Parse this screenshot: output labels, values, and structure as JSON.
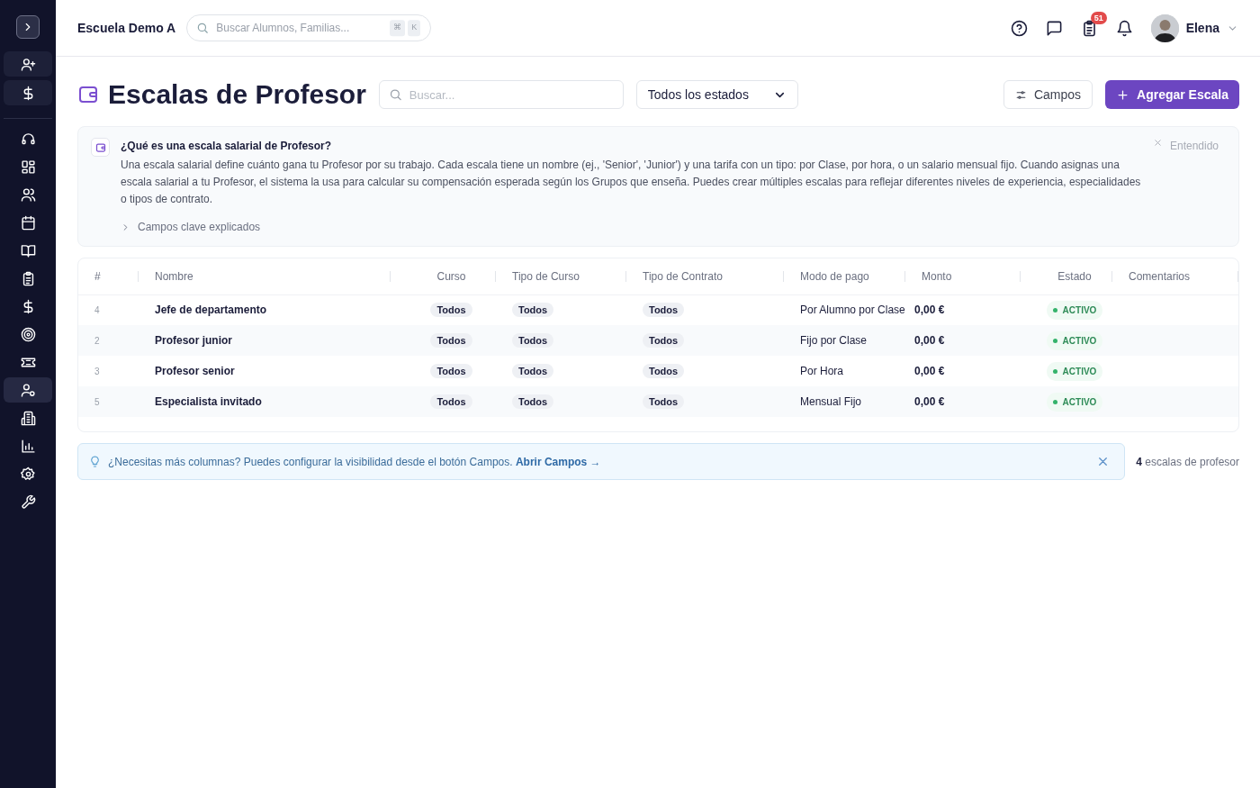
{
  "sidebar": {
    "items": [
      {
        "selected": false
      },
      {
        "selected": false
      },
      {
        "selected": false
      },
      {
        "selected": false
      },
      {
        "selected": false
      },
      {
        "selected": false
      },
      {
        "selected": false
      },
      {
        "selected": false
      },
      {
        "selected": false
      },
      {
        "selected": true
      },
      {
        "selected": false
      },
      {
        "selected": false
      },
      {
        "selected": false
      },
      {
        "selected": false
      }
    ]
  },
  "header": {
    "school": "Escuela Demo A",
    "search": {
      "placeholder": "Buscar Alumnos, Familias...",
      "shortcut_keys": [
        "⌘",
        "K"
      ]
    },
    "tasks_badge": "51",
    "user": "Elena"
  },
  "page": {
    "title": "Escalas de Profesor",
    "search": {
      "placeholder": "Buscar..."
    },
    "status_filter": "Todos los estados",
    "fields_button": "Campos",
    "add_button": "Agregar Escala"
  },
  "info": {
    "title": "¿Qué es una escala salarial de Profesor?",
    "text": "Una escala salarial define cuánto gana tu Profesor por su trabajo. Cada escala tiene un nombre (ej., 'Senior', 'Junior') y una tarifa con un tipo: por Clase, por hora, o un salario mensual fijo. Cuando asignas una escala salarial a tu Profesor, el sistema la usa para calcular su compensación esperada según los Grupos que enseña. Puedes crear múltiples escalas para reflejar diferentes niveles de experiencia, especialidades o tipos de contrato.",
    "expander": "Campos clave explicados",
    "expanded": false,
    "dismiss": "Entendido"
  },
  "table": {
    "columns": [
      "#",
      "Nombre",
      "Curso",
      "Tipo de Curso",
      "Tipo de Contrato",
      "Modo de pago",
      "Monto",
      "Estado",
      "Comentarios"
    ],
    "rows": [
      {
        "id": "4",
        "name": "Jefe de departamento",
        "course": "Todos",
        "course_type": "Todos",
        "contract_type": "Todos",
        "pay_mode": "Por Alumno por Clase",
        "amount": "0,00 €",
        "status": "ACTIVO"
      },
      {
        "id": "2",
        "name": "Profesor junior",
        "course": "Todos",
        "course_type": "Todos",
        "contract_type": "Todos",
        "pay_mode": "Fijo por Clase",
        "amount": "0,00 €",
        "status": "ACTIVO"
      },
      {
        "id": "3",
        "name": "Profesor senior",
        "course": "Todos",
        "course_type": "Todos",
        "contract_type": "Todos",
        "pay_mode": "Por Hora",
        "amount": "0,00 €",
        "status": "ACTIVO"
      },
      {
        "id": "5",
        "name": "Especialista invitado",
        "course": "Todos",
        "course_type": "Todos",
        "contract_type": "Todos",
        "pay_mode": "Mensual Fijo",
        "amount": "0,00 €",
        "status": "ACTIVO"
      }
    ]
  },
  "tip": {
    "text": "¿Necesitas más columnas? Puedes configurar la visibilidad desde el botón Campos.",
    "link": "Abrir Campos →"
  },
  "count": {
    "number": "4",
    "label": "escalas de profesor"
  }
}
